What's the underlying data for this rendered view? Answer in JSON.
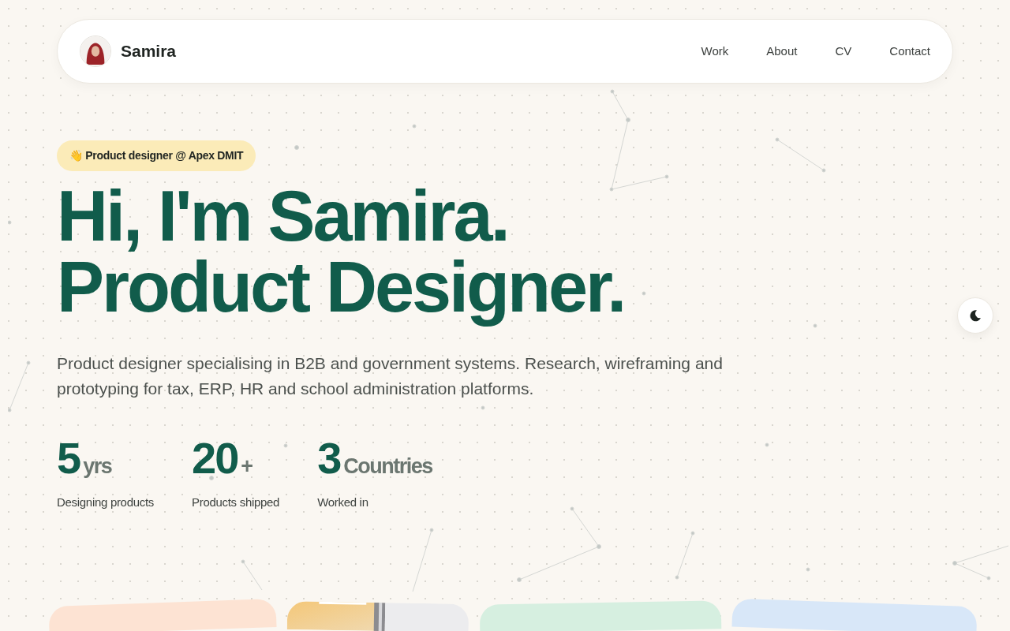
{
  "nav": {
    "brand": "Samira",
    "links": [
      "Work",
      "About",
      "CV",
      "Contact"
    ]
  },
  "hero": {
    "badge": "👋 Product designer @ Apex DMIT",
    "headline": [
      "Hi, I'm Samira.",
      "Product Designer."
    ],
    "description": "Product designer specialising in B2B and government systems. Research, wireframing and prototyping for tax, ERP, HR and school administration platforms.",
    "stats": [
      {
        "value": "5",
        "unit": "yrs",
        "label": "Designing products"
      },
      {
        "value": "20",
        "unit": "+",
        "label": "Products shipped"
      },
      {
        "value": "3",
        "unit": "Countries",
        "label": "Worked in"
      }
    ]
  },
  "cards": [
    {
      "kind": "plain",
      "color": "#fde3d3"
    },
    {
      "kind": "picture"
    },
    {
      "kind": "plain",
      "color": "#d6efe0"
    },
    {
      "kind": "plain",
      "color": "#d8e7f8"
    }
  ]
}
